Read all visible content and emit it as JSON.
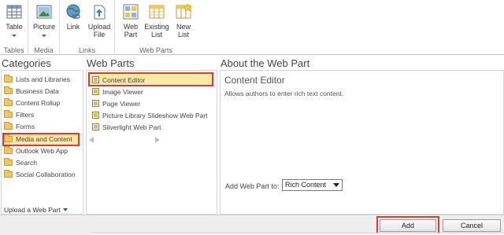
{
  "ribbon": {
    "groups": [
      {
        "label": "Tables",
        "buttons": [
          {
            "label": "Table",
            "icon": "table-icon",
            "dropdown": true
          }
        ]
      },
      {
        "label": "Media",
        "buttons": [
          {
            "label": "Picture",
            "icon": "picture-icon",
            "dropdown": true
          }
        ]
      },
      {
        "label": "Links",
        "buttons": [
          {
            "label": "Link",
            "icon": "globe-link-icon"
          },
          {
            "label_line1": "Upload",
            "label_line2": "File",
            "icon": "upload-file-icon"
          }
        ]
      },
      {
        "label": "Web Parts",
        "buttons": [
          {
            "label_line1": "Web",
            "label_line2": "Part",
            "icon": "web-part-icon"
          },
          {
            "label_line1": "Existing",
            "label_line2": "List",
            "icon": "existing-list-icon"
          },
          {
            "label_line1": "New",
            "label_line2": "List",
            "icon": "new-list-icon"
          }
        ]
      }
    ],
    "table_label": "Table",
    "picture_label": "Picture",
    "link_label": "Link",
    "upload_l1": "Upload",
    "upload_l2": "File",
    "webpart_l1": "Web",
    "webpart_l2": "Part",
    "existing_l1": "Existing",
    "existing_l2": "List",
    "newlist_l1": "New",
    "newlist_l2": "List",
    "group_tables": "Tables",
    "group_media": "Media",
    "group_links": "Links",
    "group_webparts": "Web Parts"
  },
  "categories": {
    "title": "Categories",
    "items": [
      "Lists and Libraries",
      "Business Data",
      "Content Rollup",
      "Filters",
      "Forms",
      "Media and Content",
      "Outlook Web App",
      "Search",
      "Social Collaboration"
    ],
    "selected": "Media and Content",
    "upload_link": "Upload a Web Part"
  },
  "web_parts": {
    "title": "Web Parts",
    "items": [
      "Content Editor",
      "Image Viewer",
      "Page Viewer",
      "Picture Library Slideshow Web Part",
      "Silverlight Web Part"
    ],
    "selected": "Content Editor"
  },
  "about": {
    "title": "About the Web Part",
    "part_name": "Content Editor",
    "description": "Allows authors to enter rich text content.",
    "add_to_label": "Add Web Part to:",
    "add_to_value": "Rich Content"
  },
  "footer": {
    "add_label": "Add",
    "cancel_label": "Cancel"
  },
  "colors": {
    "highlight_border": "#d93a3a",
    "selection_fill": "#fbe7a6",
    "folder": "#f3c85a"
  }
}
